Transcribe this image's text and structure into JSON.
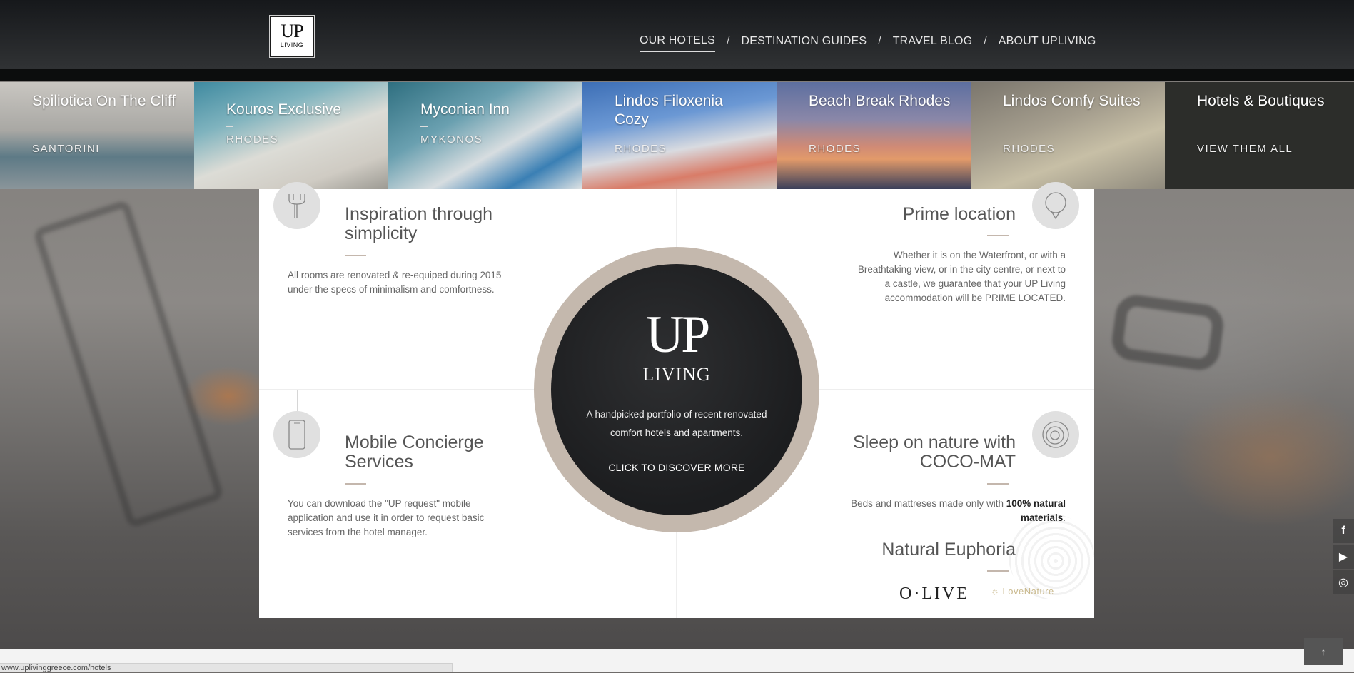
{
  "header": {
    "logo_up": "UP",
    "logo_living": "LIVING",
    "nav": [
      {
        "label": "OUR HOTELS",
        "active": true
      },
      {
        "label": "DESTINATION GUIDES",
        "active": false
      },
      {
        "label": "TRAVEL BLOG",
        "active": false
      },
      {
        "label": "ABOUT UPLIVING",
        "active": false
      }
    ],
    "separator": "/"
  },
  "hotels": [
    {
      "name": "Spiliotica On The Cliff",
      "place": "SANTORINI"
    },
    {
      "name": "Kouros Exclusive",
      "place": "RHODES"
    },
    {
      "name": "Myconian Inn",
      "place": "MYKONOS"
    },
    {
      "name": "Lindos Filoxenia Cozy",
      "place": "RHODES"
    },
    {
      "name": "Beach Break Rhodes",
      "place": "RHODES"
    },
    {
      "name": "Lindos Comfy Suites",
      "place": "RHODES"
    },
    {
      "name": "Hotels & Boutiques",
      "place": "VIEW THEM ALL"
    }
  ],
  "features": {
    "inspiration": {
      "title": "Inspiration through simplicity",
      "text": "All rooms are renovated & re-equiped during 2015 under the specs of minimalism and comfortness."
    },
    "location": {
      "title": "Prime location",
      "text": "Whether it is on the Waterfront, or with a Breathtaking view, or in the city centre, or next to a castle, we guarantee that your UP Living accommodation will be PRIME LOCATED."
    },
    "concierge": {
      "title": "Mobile Concierge Services",
      "text": "You can download  the \"UP request\" mobile application and use it in order to request basic services from the hotel manager."
    },
    "sleep": {
      "title": "Sleep on nature with COCO-MAT",
      "text_pre": "Beds and mattreses made only with ",
      "text_bold": "100% natural materials",
      "text_post": "."
    },
    "euphoria": {
      "title": "Natural Euphoria",
      "brand1": "O·LIVE",
      "brand2": "LoveNature"
    }
  },
  "center": {
    "logo_up": "UP",
    "logo_living": "LIVING",
    "tagline": "A handpicked portfolio of recent renovated comfort hotels and apartments.",
    "cta": "CLICK TO DISCOVER MORE"
  },
  "social": [
    {
      "icon": "facebook-icon",
      "glyph": "f"
    },
    {
      "icon": "youtube-icon",
      "glyph": "▶"
    },
    {
      "icon": "instagram-icon",
      "glyph": "◎"
    }
  ],
  "back_to_top": "↑",
  "status_url": "www.uplivinggreece.com/hotels",
  "colors": {
    "accent": "#c4b8ad",
    "dark": "#1f2022",
    "header": "#25272a"
  }
}
